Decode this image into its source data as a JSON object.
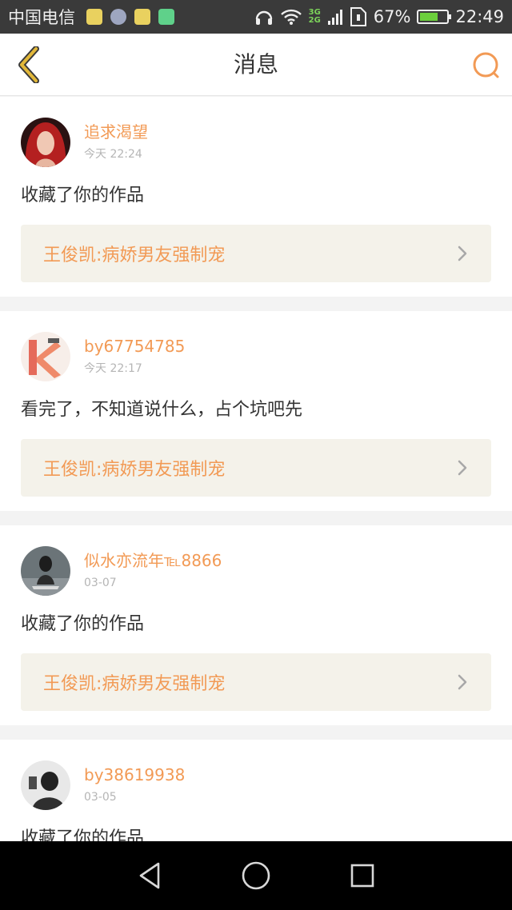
{
  "status_bar": {
    "carrier": "中国电信",
    "network": [
      "3G",
      "2G"
    ],
    "battery": "67%",
    "battery_level": 0.67,
    "time": "22:49",
    "icons": [
      "headphone-icon",
      "wifi-icon",
      "signal-icon",
      "sim-icon",
      "battery-icon"
    ]
  },
  "header": {
    "title": "消息",
    "back_icon": "chevron-left-icon",
    "search_icon": "search-icon"
  },
  "colors": {
    "accent": "#f29a55",
    "link_bg": "#f4f2ea",
    "back_icon": "#e2b83a"
  },
  "messages": [
    {
      "user": "追求渴望",
      "time": "今天 22:24",
      "text": "收藏了你的作品",
      "work": "王俊凯:病娇男友强制宠"
    },
    {
      "user": "by67754785",
      "time": "今天 22:17",
      "text": "看完了，不知道说什么，占个坑吧先",
      "work": "王俊凯:病娇男友强制宠"
    },
    {
      "user": "似水亦流年℡8866",
      "time": "03-07",
      "text": "收藏了你的作品",
      "work": "王俊凯:病娇男友强制宠"
    },
    {
      "user": "by38619938",
      "time": "03-05",
      "text": "收藏了你的作品",
      "work": ""
    }
  ],
  "nav_bar": {
    "icons": [
      "back-triangle-icon",
      "home-circle-icon",
      "recents-square-icon"
    ]
  }
}
